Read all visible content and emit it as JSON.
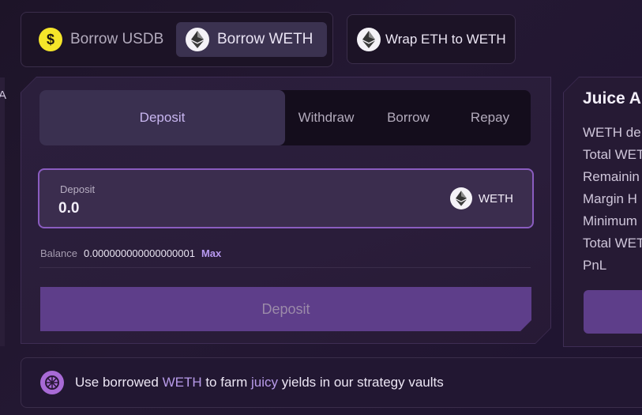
{
  "toggle": {
    "usdb_label": "Borrow USDB",
    "weth_label": "Borrow WETH",
    "usdb_icon": "usdb-coin-icon",
    "weth_icon": "eth-icon"
  },
  "wrap": {
    "label": "Wrap ETH to WETH",
    "icon": "eth-icon"
  },
  "tabs": [
    {
      "label": "Deposit",
      "active": true
    },
    {
      "label": "Withdraw"
    },
    {
      "label": "Borrow"
    },
    {
      "label": "Repay"
    }
  ],
  "input": {
    "label": "Deposit",
    "value": "0.0",
    "token": "WETH",
    "token_icon": "eth-icon"
  },
  "balance": {
    "label": "Balance",
    "value": "0.000000000000000001",
    "max_label": "Max"
  },
  "action": {
    "label": "Deposit"
  },
  "side": {
    "title": "Juice A",
    "items": [
      "WETH de",
      "Total WET",
      "Remainin",
      "Margin H",
      "Minimum",
      "Total WET",
      "PnL"
    ]
  },
  "promo": {
    "pre": "Use borrowed ",
    "token": "WETH",
    "mid": " to farm ",
    "highlight": "juicy",
    "post": " yields in our strategy vaults",
    "icon": "lime-icon"
  },
  "colors": {
    "accent": "#8a5cc0",
    "button": "#5e3e8a",
    "highlight": "#b89be9",
    "usdb_coin": "#f5e52a"
  }
}
